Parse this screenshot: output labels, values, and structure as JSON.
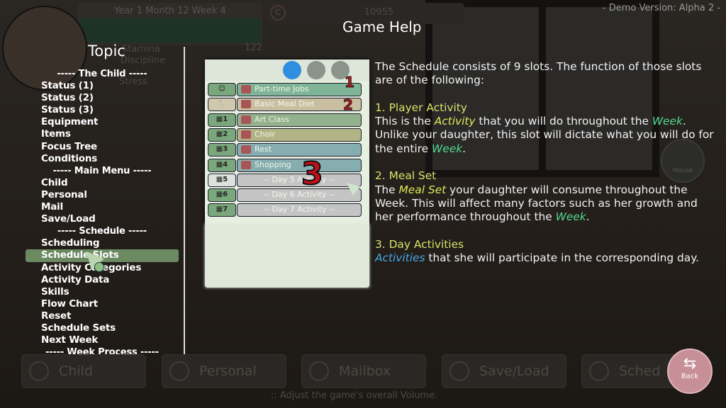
{
  "background": {
    "date": "Year 1 Month 12 Week 4",
    "money": "10955",
    "stat_value": "122",
    "stat_labels": [
      "Stamina",
      "Discipline",
      "Stress"
    ],
    "house_label": "House",
    "nav_buttons": [
      "Child",
      "Personal",
      "Mailbox",
      "Save/Load",
      "Sched"
    ],
    "hint": ":: Adjust the game's overall Volume."
  },
  "version": "- Demo Version: Alpha 2 -",
  "title": "Game Help",
  "topic_heading": "Topic",
  "topics": [
    {
      "label": "----- The Child -----",
      "header": true
    },
    {
      "label": "Status (1)"
    },
    {
      "label": "Status (2)"
    },
    {
      "label": "Status (3)"
    },
    {
      "label": "Equipment"
    },
    {
      "label": "Items"
    },
    {
      "label": "Focus Tree"
    },
    {
      "label": "Conditions"
    },
    {
      "label": "----- Main Menu -----",
      "header": true
    },
    {
      "label": "Child"
    },
    {
      "label": "Personal"
    },
    {
      "label": "Mail"
    },
    {
      "label": "Save/Load"
    },
    {
      "label": "----- Schedule -----",
      "header": true
    },
    {
      "label": "Scheduling"
    },
    {
      "label": "Schedule Slots",
      "selected": true
    },
    {
      "label": "Activity Categories"
    },
    {
      "label": "Activity Data"
    },
    {
      "label": "Skills"
    },
    {
      "label": "Flow Chart"
    },
    {
      "label": "Reset"
    },
    {
      "label": "Schedule Sets"
    },
    {
      "label": "Next Week"
    },
    {
      "label": "----- Week Process -----",
      "header": true
    }
  ],
  "illustration": {
    "slots": [
      {
        "key": "☺",
        "label": "Part-time Jobs",
        "color": "#7fb596",
        "keycolor": "#7aa77c"
      },
      {
        "key": "🍴",
        "label": "Basic Meal Diet",
        "color": "#c9bfa0",
        "keycolor": "#cfc8ac"
      },
      {
        "key": "▦1",
        "label": "Art Class",
        "color": "#93b18c",
        "keycolor": "#7aa77c"
      },
      {
        "key": "▦2",
        "label": "Choir",
        "color": "#b2b486",
        "keycolor": "#7aa77c"
      },
      {
        "key": "▦3",
        "label": "Rest",
        "color": "#86aeb0",
        "keycolor": "#7aa77c"
      },
      {
        "key": "▦4",
        "label": "Shopping",
        "color": "#86aeb0",
        "keycolor": "#7aa77c"
      },
      {
        "key": "▦5",
        "label": "-- Day 5 Activity --",
        "color": "#c4c4c4",
        "keycolor": "#dde2dc"
      },
      {
        "key": "▦6",
        "label": "-- Day 6 Activity --",
        "color": "#c4c4c4",
        "keycolor": "#7aa77c"
      },
      {
        "key": "▦7",
        "label": "-- Day 7 Activity --",
        "color": "#c4c4c4",
        "keycolor": "#7aa77c"
      }
    ],
    "markers": [
      "1",
      "2",
      "3"
    ]
  },
  "help": {
    "intro": "The Schedule consists of 9 slots. The function of those slots are of the following:",
    "s1_title": "1. Player Activity",
    "s1_a": "This is the ",
    "s1_b": "Activity",
    "s1_c": " that you will do throughout the ",
    "s1_d": "Week",
    "s1_e": ". Unlike your daughter, this slot will dictate what you will do for the entire ",
    "s1_f": "Week",
    "s1_g": ".",
    "s2_title": "2. Meal Set",
    "s2_a": "The ",
    "s2_b": "Meal Set",
    "s2_c": " your daughter will consume throughout the Week. This will affect many factors such as her growth and her performance throughout the ",
    "s2_d": "Week",
    "s2_e": ".",
    "s3_title": "3. Day Activities",
    "s3_a": "Activities",
    "s3_b": " that she will participate in the corresponding day."
  },
  "back_label": "Back",
  "colors": {
    "selected": "#6b8a62",
    "yellow": "#e3e85a",
    "green": "#55d88c",
    "blue": "#4aa6e8",
    "back": "#c78f97"
  }
}
